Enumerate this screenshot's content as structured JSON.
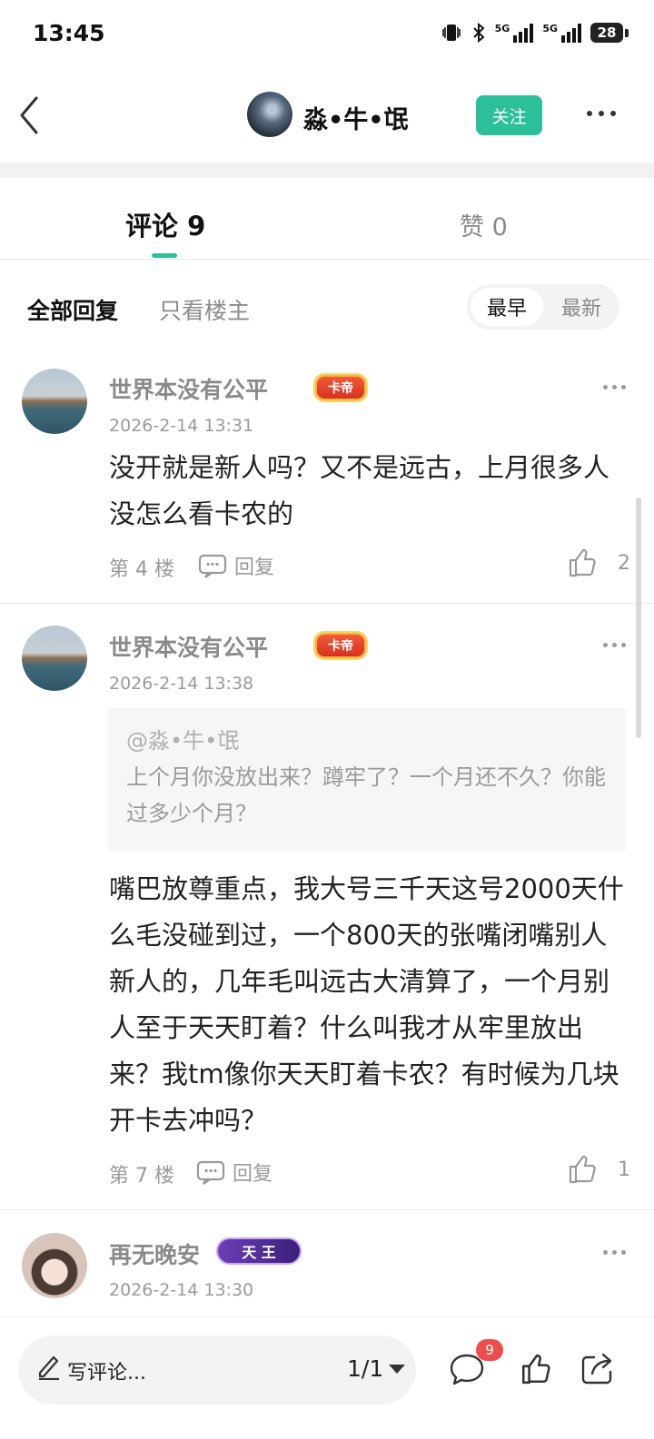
{
  "status_bar": {
    "time": "13:45",
    "network_1": "5G",
    "network_2": "5G",
    "battery": "28"
  },
  "header": {
    "username": "淼•牛•氓",
    "follow_label": "关注"
  },
  "tabs": {
    "comments": "评论 9",
    "likes": "赞 0"
  },
  "filters": {
    "all": "全部回复",
    "op_only": "只看楼主",
    "sort_earliest": "最早",
    "sort_latest": "最新"
  },
  "comments": [
    {
      "username": "世界本没有公平",
      "badge": "卡帝",
      "time": "2026-2-14 13:31",
      "text": "没开就是新人吗？又不是远古，上月很多人没怎么看卡农的",
      "floor": "第 4 楼",
      "reply_label": "回复",
      "likes": "2"
    },
    {
      "username": "世界本没有公平",
      "badge": "卡帝",
      "time": "2026-2-14 13:38",
      "quote_name": "@淼•牛•氓",
      "quote_text": "上个月你没放出来？蹲牢了？一个月还不久？你能过多少个月？",
      "text": "嘴巴放尊重点，我大号三千天这号2000天什么毛没碰到过，一个800天的张嘴闭嘴别人新人的，几年毛叫远古大清算了，一个月别人至于天天盯着？什么叫我才从牢里放出来？我tm像你天天盯着卡农？有时候为几块开卡去冲吗？",
      "floor": "第 7 楼",
      "reply_label": "回复",
      "likes": "1"
    },
    {
      "username": "再无晚安",
      "badge": "天 王",
      "time": "2026-2-14 13:30"
    }
  ],
  "bottom_bar": {
    "write_placeholder": "写评论...",
    "page": "1/1",
    "comment_count": "9"
  },
  "colors": {
    "accent": "#2bbf9a",
    "badge_red": "#ee4d4d"
  }
}
